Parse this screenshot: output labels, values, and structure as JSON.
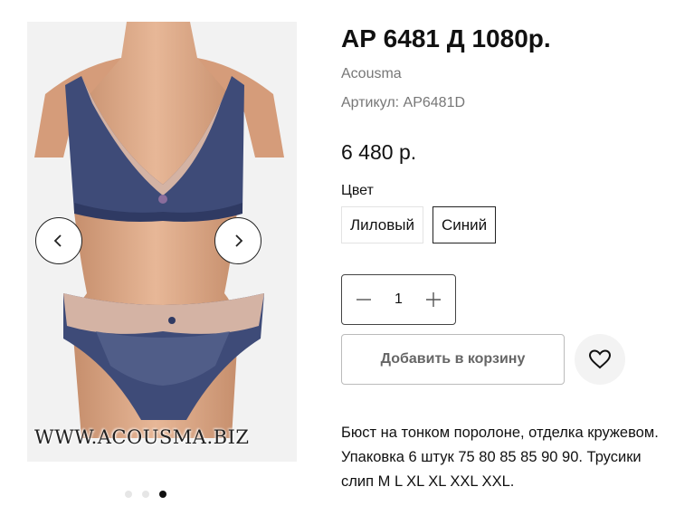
{
  "product": {
    "title": "АР 6481 Д 1080р.",
    "brand": "Acousma",
    "sku": "Артикул: AP6481D",
    "price": "6 480 р.",
    "description": "Бюст на тонком поролоне, отделка кружевом. Упаковка 6 штук 75 80 85 85 90 90. Трусики слип M L XL XL XXL XXL."
  },
  "gallery": {
    "watermark": "WWW.ACOUSMA.BIZ",
    "prev_icon": "chevron-left-icon",
    "next_icon": "chevron-right-icon",
    "slide_count": 3,
    "active_slide": 3
  },
  "color": {
    "label": "Цвет",
    "options": [
      "Лиловый",
      "Синий"
    ],
    "selected": "Синий"
  },
  "quantity": {
    "value": "1",
    "minus_icon": "minus-icon",
    "plus_icon": "plus-icon"
  },
  "actions": {
    "add_to_cart": "Добавить в корзину",
    "wishlist_icon": "heart-icon"
  },
  "colors": {
    "fabric": "#3e4b78",
    "lace": "#d4b3a4",
    "mannequin": "#dcaa88",
    "background": "#f2f2f2"
  }
}
